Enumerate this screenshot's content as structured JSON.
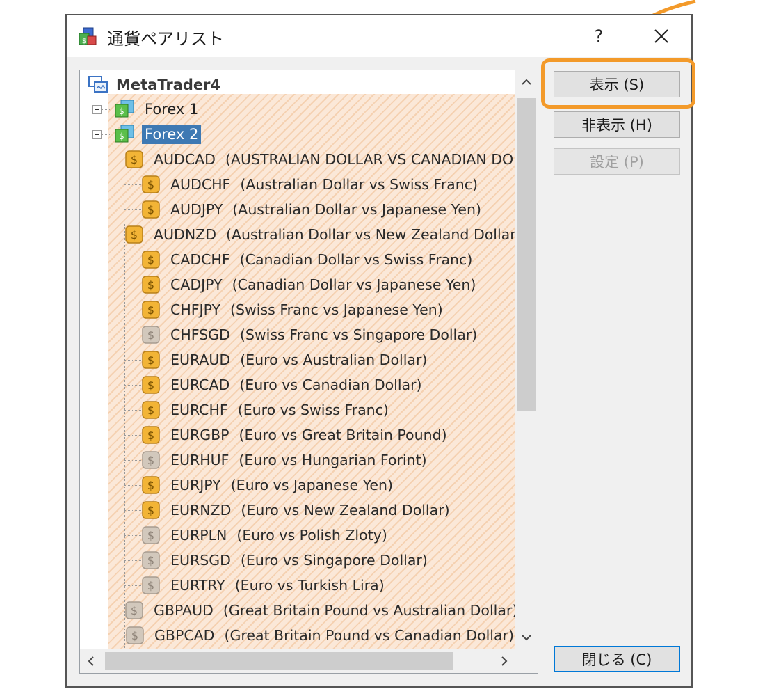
{
  "window": {
    "title": "通貨ペアリスト",
    "help_label": "?"
  },
  "tree": {
    "root_label": "MetaTrader4",
    "groups": [
      {
        "label": "Forex 1",
        "expanded": false,
        "selected": false
      },
      {
        "label": "Forex 2",
        "expanded": true,
        "selected": true
      }
    ],
    "items": [
      {
        "symbol": "AUDCAD",
        "desc": "(AUSTRALIAN DOLLAR VS CANADIAN DOLLAR)",
        "active": true
      },
      {
        "symbol": "AUDCHF",
        "desc": "(Australian Dollar vs Swiss Franc)",
        "active": true
      },
      {
        "symbol": "AUDJPY",
        "desc": "(Australian Dollar vs Japanese Yen)",
        "active": true
      },
      {
        "symbol": "AUDNZD",
        "desc": "(Australian Dollar vs New Zealand Dollar)",
        "active": true
      },
      {
        "symbol": "CADCHF",
        "desc": "(Canadian Dollar vs Swiss Franc)",
        "active": true
      },
      {
        "symbol": "CADJPY",
        "desc": "(Canadian Dollar vs Japanese Yen)",
        "active": true
      },
      {
        "symbol": "CHFJPY",
        "desc": "(Swiss Franc vs Japanese Yen)",
        "active": true
      },
      {
        "symbol": "CHFSGD",
        "desc": "(Swiss Franc vs Singapore Dollar)",
        "active": false
      },
      {
        "symbol": "EURAUD",
        "desc": "(Euro vs Australian Dollar)",
        "active": true
      },
      {
        "symbol": "EURCAD",
        "desc": "(Euro vs Canadian Dollar)",
        "active": true
      },
      {
        "symbol": "EURCHF",
        "desc": "(Euro vs Swiss Franc)",
        "active": true
      },
      {
        "symbol": "EURGBP",
        "desc": "(Euro vs Great Britain Pound)",
        "active": true
      },
      {
        "symbol": "EURHUF",
        "desc": "(Euro vs Hungarian Forint)",
        "active": false
      },
      {
        "symbol": "EURJPY",
        "desc": "(Euro vs Japanese Yen)",
        "active": true
      },
      {
        "symbol": "EURNZD",
        "desc": "(Euro vs New Zealand Dollar)",
        "active": true
      },
      {
        "symbol": "EURPLN",
        "desc": "(Euro vs Polish Zloty)",
        "active": false
      },
      {
        "symbol": "EURSGD",
        "desc": "(Euro vs Singapore Dollar)",
        "active": false
      },
      {
        "symbol": "EURTRY",
        "desc": "(Euro vs Turkish Lira)",
        "active": false
      },
      {
        "symbol": "GBPAUD",
        "desc": "(Great Britain Pound vs Australian Dollar)",
        "active": false
      },
      {
        "symbol": "GBPCAD",
        "desc": "(Great Britain Pound vs Canadian Dollar)",
        "active": false
      }
    ]
  },
  "buttons": {
    "show": "表示 (S)",
    "hide": "非表示 (H)",
    "settings": "設定 (P)",
    "close": "閉じる (C)"
  },
  "colors": {
    "accent_highlight": "#f39a2a",
    "selection": "#3e79b3",
    "coin_active": "#f2b436",
    "coin_inactive": "#d2c8bc"
  }
}
